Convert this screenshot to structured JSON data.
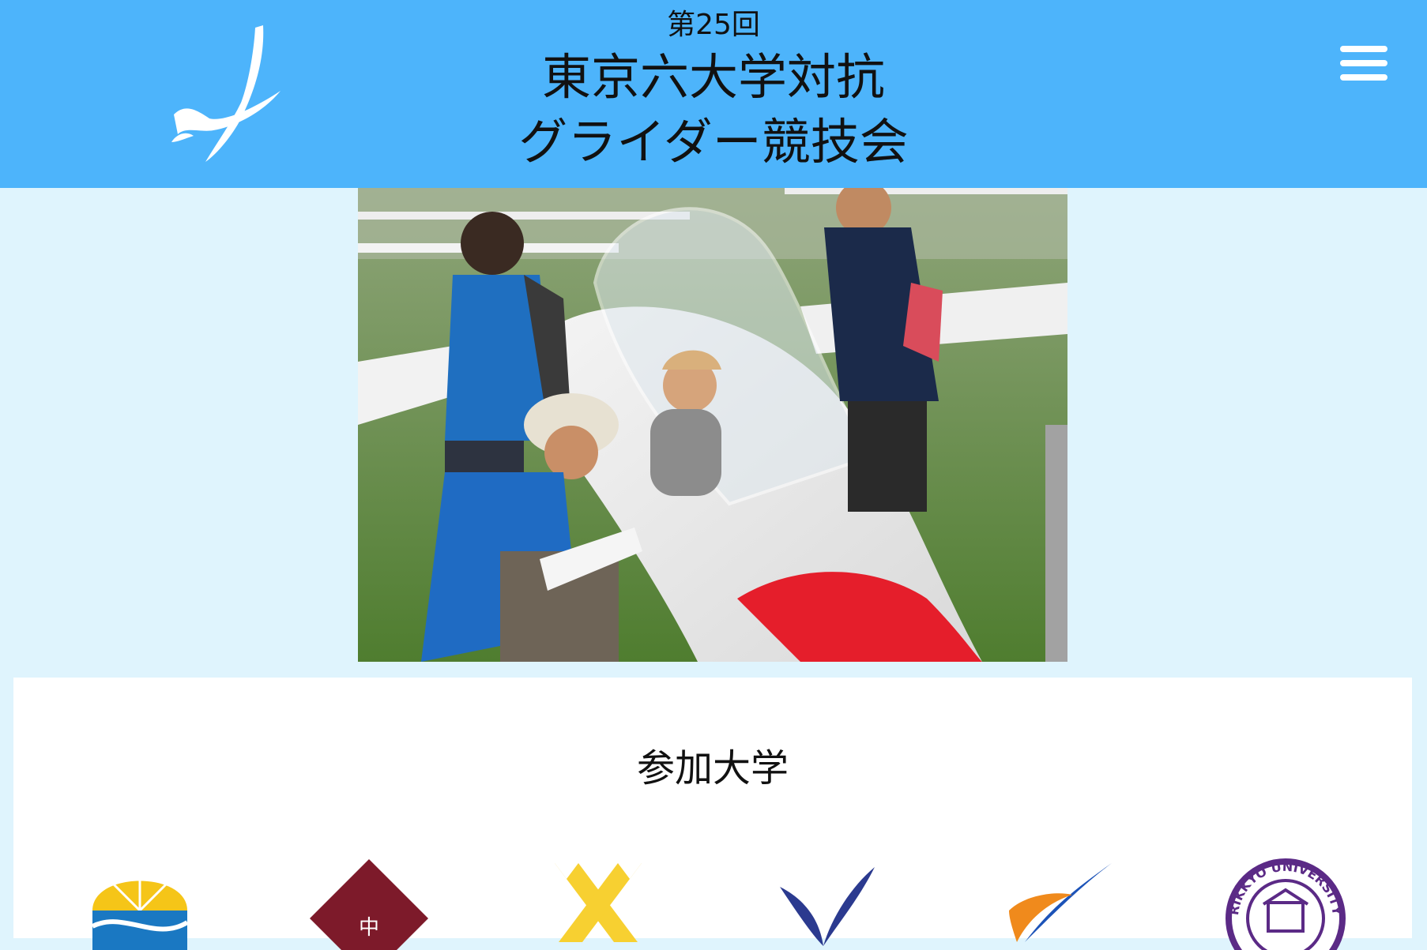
{
  "header": {
    "edition": "第25回",
    "title_line1": "東京六大学対抗",
    "title_line2": "グライダー競技会",
    "background_color": "#4db4fb",
    "logo_icon": "glider-logo-icon",
    "menu_icon": "hamburger-menu-icon"
  },
  "hero": {
    "image_icon": "glider-cockpit-photo"
  },
  "participants": {
    "heading": "参加大学",
    "universities": [
      {
        "icon": "university-ginkgo-logo-icon",
        "color": "#f5c518"
      },
      {
        "icon": "university-maroon-diamond-logo-icon",
        "color": "#7d1a2a",
        "mark": "中"
      },
      {
        "icon": "university-pen-cross-logo-icon",
        "color": "#f7d031"
      },
      {
        "icon": "university-blue-wings-logo-icon",
        "color": "#2b3a8f"
      },
      {
        "icon": "university-orange-blue-swoosh-logo-icon",
        "color": "#f08a1c"
      },
      {
        "icon": "university-rikkyo-seal-icon",
        "color": "#5b2a86",
        "seal_text": "RIKKYO UNIVERSITY"
      }
    ]
  },
  "colors": {
    "page_background": "#dff4fd",
    "card_background": "#ffffff"
  }
}
